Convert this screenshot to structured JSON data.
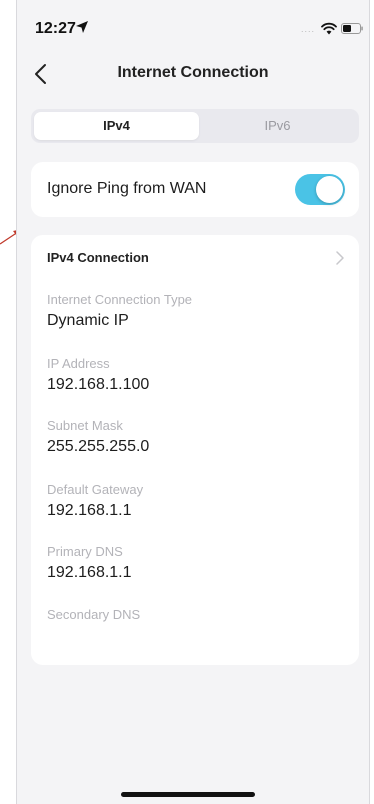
{
  "status_bar": {
    "time": "12:27",
    "signal_dots": "....",
    "icons": [
      "location-arrow-icon",
      "wifi-icon",
      "battery-icon"
    ]
  },
  "nav": {
    "title": "Internet Connection",
    "back_icon": "chevron-left-icon"
  },
  "tabs": [
    {
      "label": "IPv4",
      "selected": true
    },
    {
      "label": "IPv6",
      "selected": false
    }
  ],
  "ping": {
    "label": "Ignore Ping from WAN",
    "enabled": true
  },
  "ipv4_card": {
    "title": "IPv4 Connection",
    "fields": [
      {
        "label": "Internet Connection Type",
        "value": "Dynamic IP"
      },
      {
        "label": "IP Address",
        "value": "192.168.1.100"
      },
      {
        "label": "Subnet Mask",
        "value": "255.255.255.0"
      },
      {
        "label": "Default Gateway",
        "value": "192.168.1.1"
      },
      {
        "label": "Primary DNS",
        "value": "192.168.1.1"
      },
      {
        "label": "Secondary DNS",
        "value": ""
      }
    ]
  },
  "colors": {
    "accent": "#4ac3e6",
    "background": "#f4f4f6",
    "label_gray": "#b3b3b8",
    "annotation_red": "#c0392b"
  }
}
